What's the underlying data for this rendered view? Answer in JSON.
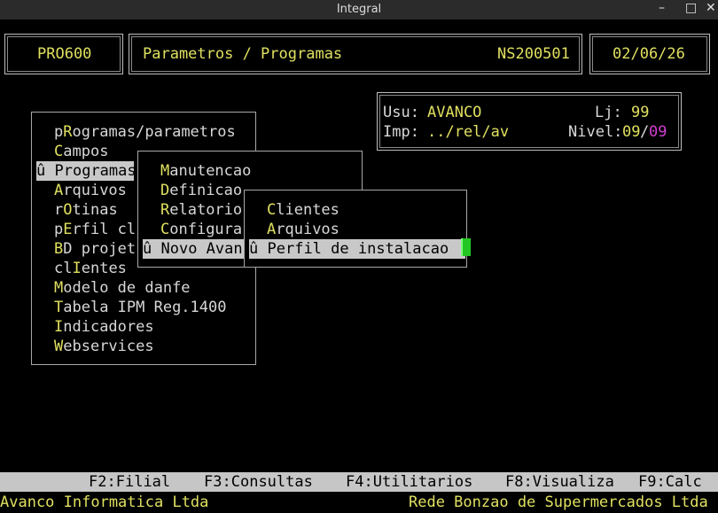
{
  "window": {
    "title": "Integral",
    "min_icon": "–",
    "max_icon": "□",
    "close_icon": "✕"
  },
  "header": {
    "program_code": "PRO600",
    "screen_title": "Parametros / Programas",
    "version": "NS200501",
    "date": "02/06/26"
  },
  "info": {
    "usu_label": "Usu:",
    "usu_value": "AVANCO",
    "lj_label": "Lj:",
    "lj_value": "99",
    "imp_label": "Imp:",
    "imp_value": "../rel/av",
    "nivel_label": "Nivel:",
    "nivel_value": "09",
    "nivel_sep": "/",
    "nivel_max": "09"
  },
  "menu1": [
    {
      "pre": "p",
      "hot": "R",
      "post": "ogramas/parametros"
    },
    {
      "pre": "",
      "hot": "C",
      "post": "ampos"
    },
    {
      "pre": "û ",
      "hot": "P",
      "post": "rogramas",
      "selected": true
    },
    {
      "pre": "",
      "hot": "A",
      "post": "rquivos"
    },
    {
      "pre": "r",
      "hot": "O",
      "post": "tinas"
    },
    {
      "pre": "p",
      "hot": "E",
      "post": "rfil cl"
    },
    {
      "pre": "",
      "hot": "B",
      "post": "D projet"
    },
    {
      "pre": "cl",
      "hot": "I",
      "post": "entes"
    },
    {
      "pre": "",
      "hot": "M",
      "post": "odelo de danfe"
    },
    {
      "pre": "",
      "hot": "T",
      "post": "abela IPM Reg.1400"
    },
    {
      "pre": "",
      "hot": "I",
      "post": "ndicadores"
    },
    {
      "pre": "",
      "hot": "W",
      "post": "ebservices"
    }
  ],
  "menu2": [
    {
      "pre": "",
      "hot": "M",
      "post": "anutencao"
    },
    {
      "pre": "",
      "hot": "D",
      "post": "efinicao"
    },
    {
      "pre": "",
      "hot": "R",
      "post": "elatorio"
    },
    {
      "pre": "",
      "hot": "C",
      "post": "onfigura"
    },
    {
      "pre": "û ",
      "hot": "N",
      "post": "ovo Avan",
      "selected": true
    }
  ],
  "menu3": [
    {
      "pre": "",
      "hot": "C",
      "post": "lientes"
    },
    {
      "pre": "",
      "hot": "A",
      "post": "rquivos"
    },
    {
      "pre": "û ",
      "hot": "P",
      "post": "erfil de instalacao",
      "selected": true
    }
  ],
  "function_keys": [
    {
      "key": "F2",
      "label": "Filial"
    },
    {
      "key": "F3",
      "label": "Consultas"
    },
    {
      "key": "F4",
      "label": "Utilitarios"
    },
    {
      "key": "F8",
      "label": "Visualiza"
    },
    {
      "key": "F9",
      "label": "Calc"
    }
  ],
  "footer": {
    "left": "Avanco Informatica Ltda",
    "right": "Rede Bonzao de Supermercados Ltda"
  },
  "colors": {
    "highlight": "#e0e060",
    "magenta": "#d33fd3",
    "selection_bg": "#c8c8c8",
    "cursor": "#23c623"
  }
}
